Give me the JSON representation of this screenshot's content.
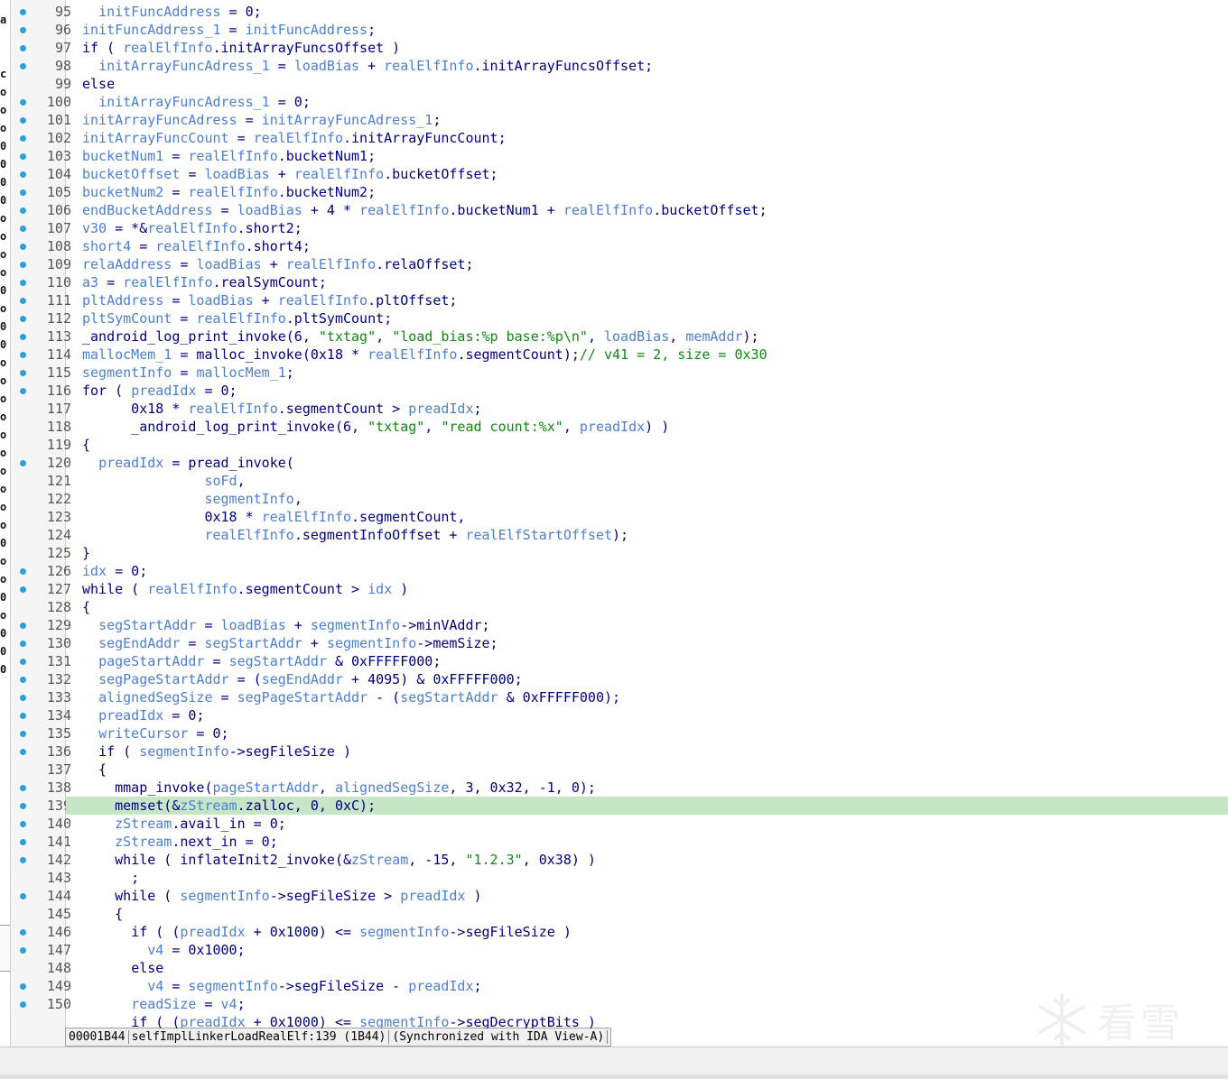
{
  "left_strip_chars": [
    "a",
    "",
    "",
    "c",
    "o",
    "o",
    "o",
    "0",
    "0",
    "0",
    "0",
    "o",
    "o",
    "o",
    "o",
    "0",
    "o",
    "0",
    "0",
    "o",
    "o",
    "o",
    "o",
    "o",
    "o",
    "o",
    "o",
    "o",
    "o",
    "0",
    "o",
    "o",
    "0",
    "o",
    "0",
    "0",
    "0"
  ],
  "highlight_line": 139,
  "code_lines": [
    {
      "n": "95",
      "dot": true,
      "tokens": [
        [
          "pl",
          "  "
        ],
        [
          "var",
          "initFuncAddress"
        ],
        [
          "pl",
          " = 0;"
        ]
      ]
    },
    {
      "n": "96",
      "dot": true,
      "tokens": [
        [
          "var",
          "initFuncAddress_1"
        ],
        [
          "pl",
          " = "
        ],
        [
          "var",
          "initFuncAddress"
        ],
        [
          "pl",
          ";"
        ]
      ]
    },
    {
      "n": "97",
      "dot": true,
      "tokens": [
        [
          "kw",
          "if"
        ],
        [
          "pl",
          " ( "
        ],
        [
          "var",
          "realElfInfo"
        ],
        [
          "pl",
          ".initArrayFuncsOffset )"
        ]
      ]
    },
    {
      "n": "98",
      "dot": true,
      "tokens": [
        [
          "pl",
          "  "
        ],
        [
          "var",
          "initArrayFuncAdress_1"
        ],
        [
          "pl",
          " = "
        ],
        [
          "var",
          "loadBias"
        ],
        [
          "pl",
          " + "
        ],
        [
          "var",
          "realElfInfo"
        ],
        [
          "pl",
          ".initArrayFuncsOffset;"
        ]
      ]
    },
    {
      "n": "99",
      "dot": false,
      "tokens": [
        [
          "kw",
          "else"
        ]
      ]
    },
    {
      "n": "100",
      "dot": true,
      "tokens": [
        [
          "pl",
          "  "
        ],
        [
          "var",
          "initArrayFuncAdress_1"
        ],
        [
          "pl",
          " = 0;"
        ]
      ]
    },
    {
      "n": "101",
      "dot": true,
      "tokens": [
        [
          "var",
          "initArrayFuncAdress"
        ],
        [
          "pl",
          " = "
        ],
        [
          "var",
          "initArrayFuncAdress_1"
        ],
        [
          "pl",
          ";"
        ]
      ]
    },
    {
      "n": "102",
      "dot": true,
      "tokens": [
        [
          "var",
          "initArrayFuncCount"
        ],
        [
          "pl",
          " = "
        ],
        [
          "var",
          "realElfInfo"
        ],
        [
          "pl",
          ".initArrayFuncCount;"
        ]
      ]
    },
    {
      "n": "103",
      "dot": true,
      "tokens": [
        [
          "var",
          "bucketNum1"
        ],
        [
          "pl",
          " = "
        ],
        [
          "var",
          "realElfInfo"
        ],
        [
          "pl",
          ".bucketNum1;"
        ]
      ]
    },
    {
      "n": "104",
      "dot": true,
      "tokens": [
        [
          "var",
          "bucketOffset"
        ],
        [
          "pl",
          " = "
        ],
        [
          "var",
          "loadBias"
        ],
        [
          "pl",
          " + "
        ],
        [
          "var",
          "realElfInfo"
        ],
        [
          "pl",
          ".bucketOffset;"
        ]
      ]
    },
    {
      "n": "105",
      "dot": true,
      "tokens": [
        [
          "var",
          "bucketNum2"
        ],
        [
          "pl",
          " = "
        ],
        [
          "var",
          "realElfInfo"
        ],
        [
          "pl",
          ".bucketNum2;"
        ]
      ]
    },
    {
      "n": "106",
      "dot": true,
      "tokens": [
        [
          "var",
          "endBucketAddress"
        ],
        [
          "pl",
          " = "
        ],
        [
          "var",
          "loadBias"
        ],
        [
          "pl",
          " + 4 * "
        ],
        [
          "var",
          "realElfInfo"
        ],
        [
          "pl",
          ".bucketNum1 + "
        ],
        [
          "var",
          "realElfInfo"
        ],
        [
          "pl",
          ".bucketOffset;"
        ]
      ]
    },
    {
      "n": "107",
      "dot": true,
      "tokens": [
        [
          "var",
          "v30"
        ],
        [
          "pl",
          " = *&"
        ],
        [
          "var",
          "realElfInfo"
        ],
        [
          "pl",
          ".short2;"
        ]
      ]
    },
    {
      "n": "108",
      "dot": true,
      "tokens": [
        [
          "var",
          "short4"
        ],
        [
          "pl",
          " = "
        ],
        [
          "var",
          "realElfInfo"
        ],
        [
          "pl",
          ".short4;"
        ]
      ]
    },
    {
      "n": "109",
      "dot": true,
      "tokens": [
        [
          "var",
          "relaAddress"
        ],
        [
          "pl",
          " = "
        ],
        [
          "var",
          "loadBias"
        ],
        [
          "pl",
          " + "
        ],
        [
          "var",
          "realElfInfo"
        ],
        [
          "pl",
          ".relaOffset;"
        ]
      ]
    },
    {
      "n": "110",
      "dot": true,
      "tokens": [
        [
          "var",
          "a3"
        ],
        [
          "pl",
          " = "
        ],
        [
          "var",
          "realElfInfo"
        ],
        [
          "pl",
          ".realSymCount;"
        ]
      ]
    },
    {
      "n": "111",
      "dot": true,
      "tokens": [
        [
          "var",
          "pltAddress"
        ],
        [
          "pl",
          " = "
        ],
        [
          "var",
          "loadBias"
        ],
        [
          "pl",
          " + "
        ],
        [
          "var",
          "realElfInfo"
        ],
        [
          "pl",
          ".pltOffset;"
        ]
      ]
    },
    {
      "n": "112",
      "dot": true,
      "tokens": [
        [
          "var",
          "pltSymCount"
        ],
        [
          "pl",
          " = "
        ],
        [
          "var",
          "realElfInfo"
        ],
        [
          "pl",
          ".pltSymCount;"
        ]
      ]
    },
    {
      "n": "113",
      "dot": true,
      "tokens": [
        [
          "pl",
          "_android_log_print_invoke(6, "
        ],
        [
          "str",
          "\"txtag\""
        ],
        [
          "pl",
          ", "
        ],
        [
          "str",
          "\"load_bias:%p base:%p\\n\""
        ],
        [
          "pl",
          ", "
        ],
        [
          "var",
          "loadBias"
        ],
        [
          "pl",
          ", "
        ],
        [
          "var",
          "memAddr"
        ],
        [
          "pl",
          ");"
        ]
      ]
    },
    {
      "n": "114",
      "dot": true,
      "tokens": [
        [
          "var",
          "mallocMem_1"
        ],
        [
          "pl",
          " = malloc_invoke(0x18 * "
        ],
        [
          "var",
          "realElfInfo"
        ],
        [
          "pl",
          ".segmentCount);"
        ],
        [
          "cmt",
          "// v41 = 2, size = 0x30"
        ]
      ]
    },
    {
      "n": "115",
      "dot": true,
      "tokens": [
        [
          "var",
          "segmentInfo"
        ],
        [
          "pl",
          " = "
        ],
        [
          "var",
          "mallocMem_1"
        ],
        [
          "pl",
          ";"
        ]
      ]
    },
    {
      "n": "116",
      "dot": true,
      "tokens": [
        [
          "kw",
          "for"
        ],
        [
          "pl",
          " ( "
        ],
        [
          "var",
          "preadIdx"
        ],
        [
          "pl",
          " = 0;"
        ]
      ]
    },
    {
      "n": "117",
      "dot": false,
      "tokens": [
        [
          "pl",
          "      0x18 * "
        ],
        [
          "var",
          "realElfInfo"
        ],
        [
          "pl",
          ".segmentCount > "
        ],
        [
          "var",
          "preadIdx"
        ],
        [
          "pl",
          ";"
        ]
      ]
    },
    {
      "n": "118",
      "dot": false,
      "tokens": [
        [
          "pl",
          "      _android_log_print_invoke(6, "
        ],
        [
          "str",
          "\"txtag\""
        ],
        [
          "pl",
          ", "
        ],
        [
          "str",
          "\"read count:%x\""
        ],
        [
          "pl",
          ", "
        ],
        [
          "var",
          "preadIdx"
        ],
        [
          "pl",
          ") )"
        ]
      ]
    },
    {
      "n": "119",
      "dot": false,
      "tokens": [
        [
          "pl",
          "{"
        ]
      ]
    },
    {
      "n": "120",
      "dot": true,
      "tokens": [
        [
          "pl",
          "  "
        ],
        [
          "var",
          "preadIdx"
        ],
        [
          "pl",
          " = pread_invoke("
        ]
      ]
    },
    {
      "n": "121",
      "dot": false,
      "tokens": [
        [
          "pl",
          "               "
        ],
        [
          "var",
          "soFd"
        ],
        [
          "pl",
          ","
        ]
      ]
    },
    {
      "n": "122",
      "dot": false,
      "tokens": [
        [
          "pl",
          "               "
        ],
        [
          "var",
          "segmentInfo"
        ],
        [
          "pl",
          ","
        ]
      ]
    },
    {
      "n": "123",
      "dot": false,
      "tokens": [
        [
          "pl",
          "               0x18 * "
        ],
        [
          "var",
          "realElfInfo"
        ],
        [
          "pl",
          ".segmentCount,"
        ]
      ]
    },
    {
      "n": "124",
      "dot": false,
      "tokens": [
        [
          "pl",
          "               "
        ],
        [
          "var",
          "realElfInfo"
        ],
        [
          "pl",
          ".segmentInfoOffset + "
        ],
        [
          "var",
          "realElfStartOffset"
        ],
        [
          "pl",
          ");"
        ]
      ]
    },
    {
      "n": "125",
      "dot": false,
      "tokens": [
        [
          "pl",
          "}"
        ]
      ]
    },
    {
      "n": "126",
      "dot": true,
      "tokens": [
        [
          "var",
          "idx"
        ],
        [
          "pl",
          " = 0;"
        ]
      ]
    },
    {
      "n": "127",
      "dot": true,
      "tokens": [
        [
          "kw",
          "while"
        ],
        [
          "pl",
          " ( "
        ],
        [
          "var",
          "realElfInfo"
        ],
        [
          "pl",
          ".segmentCount > "
        ],
        [
          "var",
          "idx"
        ],
        [
          "pl",
          " )"
        ]
      ]
    },
    {
      "n": "128",
      "dot": false,
      "tokens": [
        [
          "pl",
          "{"
        ]
      ]
    },
    {
      "n": "129",
      "dot": true,
      "tokens": [
        [
          "pl",
          "  "
        ],
        [
          "var",
          "segStartAddr"
        ],
        [
          "pl",
          " = "
        ],
        [
          "var",
          "loadBias"
        ],
        [
          "pl",
          " + "
        ],
        [
          "var",
          "segmentInfo"
        ],
        [
          "pl",
          "->minVAddr;"
        ]
      ]
    },
    {
      "n": "130",
      "dot": true,
      "tokens": [
        [
          "pl",
          "  "
        ],
        [
          "var",
          "segEndAddr"
        ],
        [
          "pl",
          " = "
        ],
        [
          "var",
          "segStartAddr"
        ],
        [
          "pl",
          " + "
        ],
        [
          "var",
          "segmentInfo"
        ],
        [
          "pl",
          "->memSize;"
        ]
      ]
    },
    {
      "n": "131",
      "dot": true,
      "tokens": [
        [
          "pl",
          "  "
        ],
        [
          "var",
          "pageStartAddr"
        ],
        [
          "pl",
          " = "
        ],
        [
          "var",
          "segStartAddr"
        ],
        [
          "pl",
          " & 0xFFFFF000;"
        ]
      ]
    },
    {
      "n": "132",
      "dot": true,
      "tokens": [
        [
          "pl",
          "  "
        ],
        [
          "var",
          "segPageStartAddr"
        ],
        [
          "pl",
          " = ("
        ],
        [
          "var",
          "segEndAddr"
        ],
        [
          "pl",
          " + 4095) & 0xFFFFF000;"
        ]
      ]
    },
    {
      "n": "133",
      "dot": true,
      "tokens": [
        [
          "pl",
          "  "
        ],
        [
          "var",
          "alignedSegSize"
        ],
        [
          "pl",
          " = "
        ],
        [
          "var",
          "segPageStartAddr"
        ],
        [
          "pl",
          " - ("
        ],
        [
          "var",
          "segStartAddr"
        ],
        [
          "pl",
          " & 0xFFFFF000);"
        ]
      ]
    },
    {
      "n": "134",
      "dot": true,
      "tokens": [
        [
          "pl",
          "  "
        ],
        [
          "var",
          "preadIdx"
        ],
        [
          "pl",
          " = 0;"
        ]
      ]
    },
    {
      "n": "135",
      "dot": true,
      "tokens": [
        [
          "pl",
          "  "
        ],
        [
          "var",
          "writeCursor"
        ],
        [
          "pl",
          " = 0;"
        ]
      ]
    },
    {
      "n": "136",
      "dot": true,
      "tokens": [
        [
          "pl",
          "  "
        ],
        [
          "kw",
          "if"
        ],
        [
          "pl",
          " ( "
        ],
        [
          "var",
          "segmentInfo"
        ],
        [
          "pl",
          "->segFileSize )"
        ]
      ]
    },
    {
      "n": "137",
      "dot": false,
      "tokens": [
        [
          "pl",
          "  {"
        ]
      ]
    },
    {
      "n": "138",
      "dot": true,
      "tokens": [
        [
          "pl",
          "    mmap_invoke("
        ],
        [
          "var",
          "pageStartAddr"
        ],
        [
          "pl",
          ", "
        ],
        [
          "var",
          "alignedSegSize"
        ],
        [
          "pl",
          ", 3, 0x32, -1, 0);"
        ]
      ]
    },
    {
      "n": "139",
      "dot": true,
      "tokens": [
        [
          "pl",
          "    memset(&"
        ],
        [
          "var",
          "zStream"
        ],
        [
          "pl",
          ".zalloc, 0, 0xC);"
        ]
      ]
    },
    {
      "n": "140",
      "dot": true,
      "tokens": [
        [
          "pl",
          "    "
        ],
        [
          "var",
          "zStream"
        ],
        [
          "pl",
          ".avail_in = 0;"
        ]
      ]
    },
    {
      "n": "141",
      "dot": true,
      "tokens": [
        [
          "pl",
          "    "
        ],
        [
          "var",
          "zStream"
        ],
        [
          "pl",
          ".next_in = 0;"
        ]
      ]
    },
    {
      "n": "142",
      "dot": true,
      "tokens": [
        [
          "pl",
          "    "
        ],
        [
          "kw",
          "while"
        ],
        [
          "pl",
          " ( inflateInit2_invoke(&"
        ],
        [
          "var",
          "zStream"
        ],
        [
          "pl",
          ", -15, "
        ],
        [
          "str",
          "\"1.2.3\""
        ],
        [
          "pl",
          ", 0x38) )"
        ]
      ]
    },
    {
      "n": "143",
      "dot": false,
      "tokens": [
        [
          "pl",
          "      ;"
        ]
      ]
    },
    {
      "n": "144",
      "dot": true,
      "tokens": [
        [
          "pl",
          "    "
        ],
        [
          "kw",
          "while"
        ],
        [
          "pl",
          " ( "
        ],
        [
          "var",
          "segmentInfo"
        ],
        [
          "pl",
          "->segFileSize > "
        ],
        [
          "var",
          "preadIdx"
        ],
        [
          "pl",
          " )"
        ]
      ]
    },
    {
      "n": "145",
      "dot": false,
      "tokens": [
        [
          "pl",
          "    {"
        ]
      ]
    },
    {
      "n": "146",
      "dot": true,
      "tokens": [
        [
          "pl",
          "      "
        ],
        [
          "kw",
          "if"
        ],
        [
          "pl",
          " ( ("
        ],
        [
          "var",
          "preadIdx"
        ],
        [
          "pl",
          " + 0x1000) <= "
        ],
        [
          "var",
          "segmentInfo"
        ],
        [
          "pl",
          "->segFileSize )"
        ]
      ]
    },
    {
      "n": "147",
      "dot": true,
      "tokens": [
        [
          "pl",
          "        "
        ],
        [
          "var",
          "v4"
        ],
        [
          "pl",
          " = 0x1000;"
        ]
      ]
    },
    {
      "n": "148",
      "dot": false,
      "tokens": [
        [
          "pl",
          "      "
        ],
        [
          "kw",
          "else"
        ]
      ]
    },
    {
      "n": "149",
      "dot": true,
      "tokens": [
        [
          "pl",
          "        "
        ],
        [
          "var",
          "v4"
        ],
        [
          "pl",
          " = "
        ],
        [
          "var",
          "segmentInfo"
        ],
        [
          "pl",
          "->segFileSize - "
        ],
        [
          "var",
          "preadIdx"
        ],
        [
          "pl",
          ";"
        ]
      ]
    },
    {
      "n": "150",
      "dot": true,
      "tokens": [
        [
          "pl",
          "      "
        ],
        [
          "var",
          "readSize"
        ],
        [
          "pl",
          " = "
        ],
        [
          "var",
          "v4"
        ],
        [
          "pl",
          ";"
        ]
      ]
    },
    {
      "n": "",
      "dot": false,
      "tokens": [
        [
          "pl",
          "      "
        ],
        [
          "kw",
          "if"
        ],
        [
          "pl",
          " ( ("
        ],
        [
          "var",
          "preadIdx"
        ],
        [
          "pl",
          " + 0x1000) <= "
        ],
        [
          "var",
          "segmentInfo"
        ],
        [
          "pl",
          "->segDecryptBits )"
        ]
      ]
    }
  ],
  "status_bar": {
    "address": "00001B44",
    "location": "selfImplLinkerLoadRealElf:139 (1B44)",
    "sync": "(Synchronized with IDA View-A)"
  },
  "watermark": {
    "text": "看雪"
  },
  "colors": {
    "variable": "#4d7fcf",
    "string": "#118811",
    "plain": "#000080",
    "highlight": "#c6e6c6",
    "dot": "#2e9fd8"
  }
}
